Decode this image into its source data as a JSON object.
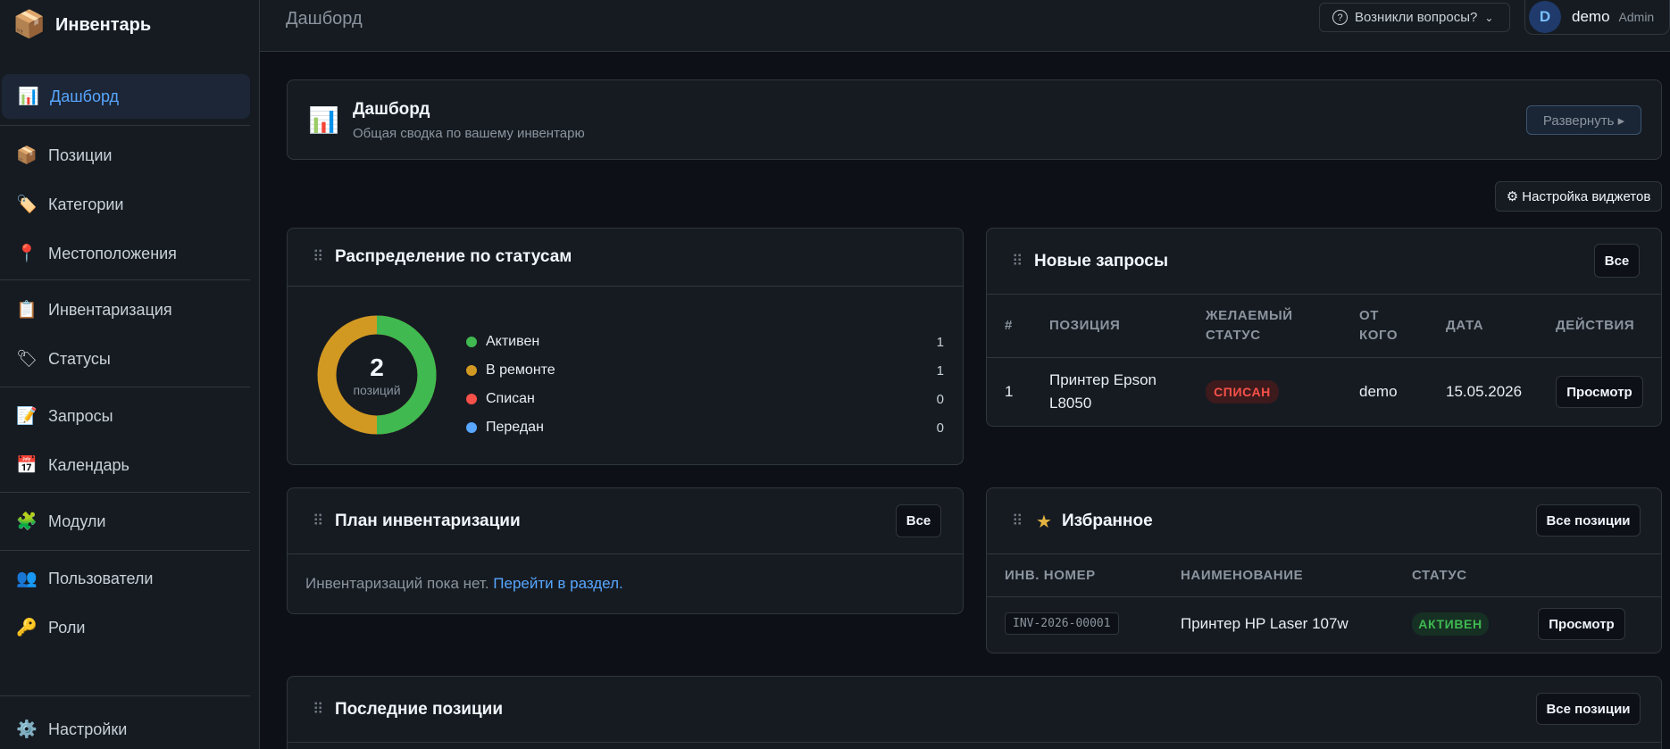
{
  "brand": {
    "icon": "📦",
    "name": "Инвентарь"
  },
  "sidebar": {
    "items": [
      {
        "icon": "📊",
        "label": "Дашборд",
        "active": true
      },
      {
        "icon": "📦",
        "label": "Позиции"
      },
      {
        "icon": "🏷️",
        "label": "Категории"
      },
      {
        "icon": "📍",
        "label": "Местоположения"
      },
      {
        "icon": "📋",
        "label": "Инвентаризация"
      },
      {
        "icon": "🏷",
        "label": "Статусы"
      },
      {
        "icon": "📝",
        "label": "Запросы"
      },
      {
        "icon": "📅",
        "label": "Календарь"
      },
      {
        "icon": "🧩",
        "label": "Модули"
      },
      {
        "icon": "👥",
        "label": "Пользователи"
      },
      {
        "icon": "🔑",
        "label": "Роли"
      },
      {
        "icon": "⚙️",
        "label": "Настройки"
      }
    ]
  },
  "topbar": {
    "title": "Дашборд",
    "help_label": "Возникли вопросы?",
    "user": {
      "initial": "D",
      "name": "demo",
      "role": "Admin"
    }
  },
  "hero": {
    "icon": "📊",
    "title": "Дашборд",
    "subtitle": "Общая сводка по вашему инвентарю",
    "expand_label": "Развернуть ▸"
  },
  "widget_settings_label": "⚙ Настройка виджетов",
  "status_widget": {
    "title": "Распределение по статусам",
    "total": "2",
    "total_label": "позиций",
    "legend": [
      {
        "name": "Активен",
        "value": "1",
        "color": "#3fb950"
      },
      {
        "name": "В ремонте",
        "value": "1",
        "color": "#d29922"
      },
      {
        "name": "Списан",
        "value": "0",
        "color": "#f85149"
      },
      {
        "name": "Передан",
        "value": "0",
        "color": "#58a6ff"
      }
    ]
  },
  "requests_widget": {
    "title": "Новые запросы",
    "all_label": "Все",
    "columns": [
      "#",
      "ПОЗИЦИЯ",
      "ЖЕЛАЕМЫЙ\nСТАТУС",
      "ОТ\nКОГО",
      "ДАТА",
      "ДЕЙСТВИЯ"
    ],
    "rows": [
      {
        "num": "1",
        "item": "Принтер Epson L8050",
        "status": "СПИСАН",
        "from": "demo",
        "date": "15.05.2026",
        "action": "Просмотр"
      }
    ]
  },
  "inventory_plan_widget": {
    "title": "План инвентаризации",
    "all_label": "Все",
    "empty_text": "Инвентаризаций пока нет.",
    "link_text": "Перейти в раздел."
  },
  "favorites_widget": {
    "star": "★",
    "title": "Избранное",
    "all_label": "Все позиции",
    "columns": [
      "ИНВ. НОМЕР",
      "НАИМЕНОВАНИЕ",
      "СТАТУС"
    ],
    "rows": [
      {
        "inv": "INV-2026-00001",
        "name": "Принтер HP Laser 107w",
        "status": "АКТИВЕН",
        "action": "Просмотр"
      }
    ]
  },
  "recent_widget": {
    "title": "Последние позиции",
    "all_label": "Все позиции"
  }
}
